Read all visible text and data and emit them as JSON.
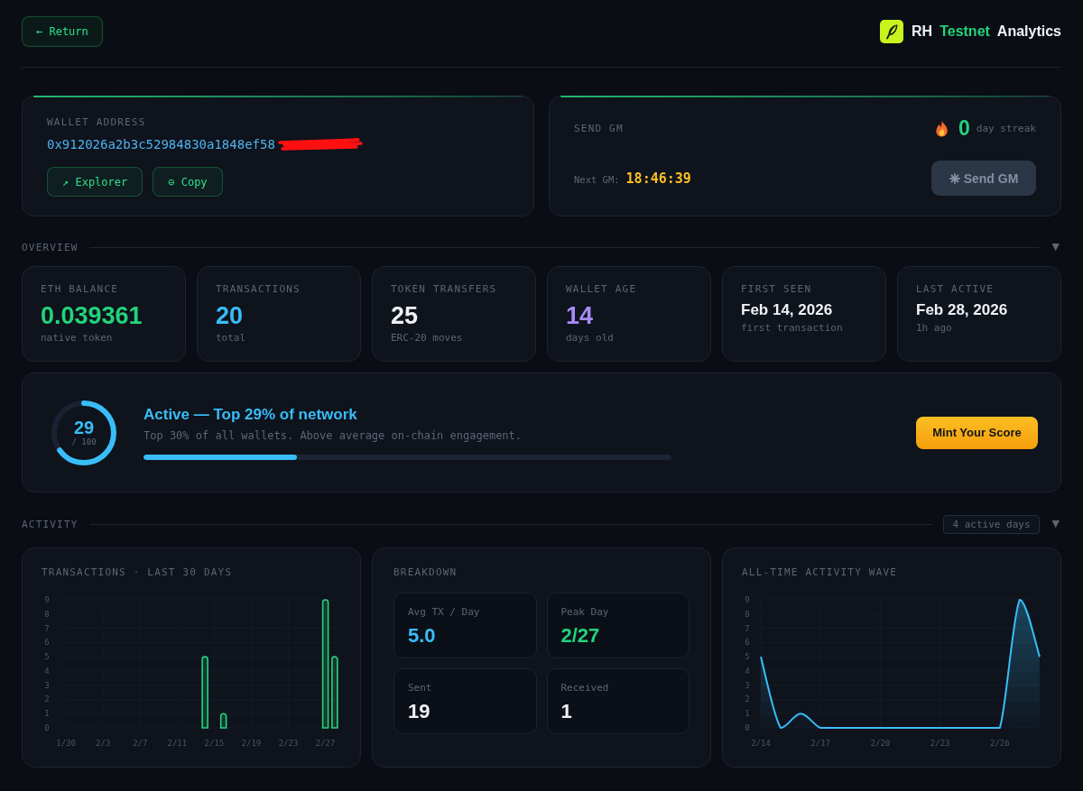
{
  "header": {
    "return_button": "← Return",
    "logo": [
      {
        "text": "RH",
        "color": "#eef2f7"
      },
      {
        "text": "Testnet",
        "color": "#22d37a"
      },
      {
        "text": "Analytics",
        "color": "#eef2f7"
      }
    ]
  },
  "wallet": {
    "label": "WALLET ADDRESS",
    "address": "0x912026a2b3c52984830a1848ef58",
    "buttons": [
      "↗ Explorer",
      "⊖ Copy"
    ]
  },
  "send_gm": {
    "title": "SEND GM",
    "streak_count": "0",
    "streak_label": "day streak",
    "next_label": "Next GM:",
    "countdown": "18:46:39",
    "button": {
      "label": "Send GM",
      "disabled": true
    }
  },
  "overview": {
    "title": "OVERVIEW",
    "toggle": "▼",
    "stats": [
      {
        "label": "ETH BALANCE",
        "value": "0.039361",
        "sub": "native token",
        "kind": "number",
        "color": "#22d37a"
      },
      {
        "label": "TRANSACTIONS",
        "value": "20",
        "sub": "total",
        "kind": "number",
        "color": "#38bdf8"
      },
      {
        "label": "TOKEN TRANSFERS",
        "value": "25",
        "sub": "ERC-20 moves",
        "kind": "number",
        "color": "#eef2f7"
      },
      {
        "label": "WALLET AGE",
        "value": "14",
        "sub": "days old",
        "kind": "number",
        "color": "#a78bfa"
      },
      {
        "label": "FIRST SEEN",
        "value": "Feb 14, 2026",
        "sub": "first transaction",
        "kind": "date",
        "color": "#eef2f7"
      },
      {
        "label": "LAST ACTIVE",
        "value": "Feb 28, 2026",
        "sub": "1h ago",
        "kind": "date",
        "color": "#eef2f7"
      }
    ]
  },
  "score": {
    "ring": {
      "value": "29",
      "scale": "/ 100",
      "level": 0.65
    },
    "title": "Active — Top 29% of network",
    "description": "Top 30% of all wallets. Above average on-chain engagement.",
    "progress": {
      "level": 0.29
    },
    "button": "Mint Your Score"
  },
  "activity": {
    "title": "ACTIVITY",
    "badge": "4 active days",
    "toggle": "▼",
    "tx_chart": {
      "title": "TRANSACTIONS · LAST 30 DAYS",
      "chart_data": {
        "type": "bar",
        "categories": [
          "1/30",
          null,
          null,
          null,
          "2/3",
          null,
          null,
          null,
          "2/7",
          null,
          null,
          null,
          "2/11",
          null,
          null,
          null,
          "2/15",
          null,
          null,
          null,
          "2/19",
          null,
          null,
          null,
          "2/23",
          null,
          null,
          null,
          "2/27",
          null
        ],
        "values": [
          0,
          0,
          0,
          0,
          0,
          0,
          0,
          0,
          0,
          0,
          0,
          0,
          0,
          0,
          0,
          5,
          0,
          1,
          0,
          0,
          0,
          0,
          0,
          0,
          0,
          0,
          0,
          0,
          9,
          5
        ],
        "ylim": [
          0,
          9
        ],
        "yticks": [
          0,
          1,
          2,
          3,
          4,
          5,
          6,
          7,
          8,
          9
        ],
        "grid": true
      }
    },
    "breakdown": {
      "title": "BREAKDOWN",
      "tiles": [
        {
          "label": "Avg TX / Day",
          "value": "5.0",
          "color": "#38bdf8"
        },
        {
          "label": "Peak Day",
          "value": "2/27",
          "color": "#22d37a"
        },
        {
          "label": "Sent",
          "value": "19",
          "color": "#eef2f7"
        },
        {
          "label": "Received",
          "value": "1",
          "color": "#eef2f7"
        }
      ]
    },
    "wave_chart": {
      "title": "ALL-TIME ACTIVITY WAVE",
      "chart_data": {
        "type": "area",
        "categories": [
          "2/14",
          null,
          null,
          "2/17",
          null,
          null,
          "2/20",
          null,
          null,
          "2/23",
          null,
          null,
          "2/26",
          null,
          null
        ],
        "values": [
          5,
          0,
          1,
          0,
          0,
          0,
          0,
          0,
          0,
          0,
          0,
          0,
          0,
          9,
          5
        ],
        "ylim": [
          0,
          9
        ],
        "yticks": [
          0,
          1,
          2,
          3,
          4,
          5,
          6,
          7,
          8,
          9
        ],
        "grid": true
      }
    }
  }
}
